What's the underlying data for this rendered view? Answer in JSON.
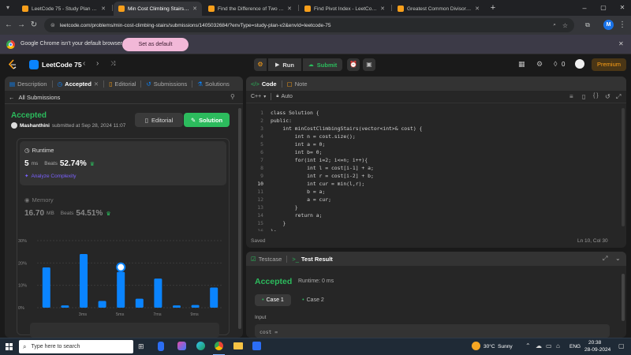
{
  "browser": {
    "tabs": [
      {
        "title": "LeetCode 75 - Study Plan - Leet",
        "active": false,
        "color": "#f89f1b"
      },
      {
        "title": "Min Cost Climbing Stairs - Leetc",
        "active": true,
        "color": "#f89f1b"
      },
      {
        "title": "Find the Difference of Two Arra",
        "active": false,
        "color": "#f89f1b"
      },
      {
        "title": "Find Pivot Index - LeetCode",
        "active": false,
        "color": "#f89f1b"
      },
      {
        "title": "Greatest Common Divisor of St",
        "active": false,
        "color": "#f89f1b"
      }
    ],
    "url": "leetcode.com/problems/min-cost-climbing-stairs/submissions/1405032684/?envType=study-plan-v2&envId=leetcode-75",
    "profile_initial": "M",
    "infobar_text": "Google Chrome isn't your default browser",
    "infobar_button": "Set as default"
  },
  "lc_nav": {
    "title": "LeetCode 75",
    "run": "Run",
    "submit": "Submit",
    "streak": "0",
    "premium": "Premium"
  },
  "left_tabs": {
    "description": "Description",
    "accepted": "Accepted",
    "editorial": "Editorial",
    "submissions": "Submissions",
    "solutions": "Solutions"
  },
  "submission": {
    "back": "All Submissions",
    "status": "Accepted",
    "user": "Mashanthini",
    "submitted": "submitted at Sep 28, 2024 11:07",
    "editorial_btn": "Editorial",
    "solution_btn": "Solution",
    "runtime_label": "Runtime",
    "runtime_value": "5",
    "runtime_unit": "ms",
    "beats_label": "Beats",
    "runtime_beats": "52.74%",
    "analyze": "Analyze Complexity",
    "memory_label": "Memory",
    "memory_value": "16.70",
    "memory_unit": "MB",
    "memory_beats": "54.51%"
  },
  "chart_data": {
    "type": "bar",
    "y_ticks": [
      "30%",
      "20%",
      "10%",
      "0%"
    ],
    "ylim": [
      0,
      30
    ],
    "x_tick_labels": [
      "3ms",
      "5ms",
      "7ms",
      "9ms"
    ],
    "values": [
      18,
      1,
      24,
      3,
      16,
      4,
      13,
      1,
      1.2,
      9
    ],
    "highlight_index": 4,
    "bar_color": "#0a84ff",
    "grid": true
  },
  "editor": {
    "tab_code": "Code",
    "tab_note": "Note",
    "language": "C++",
    "mode": "Auto",
    "lines": [
      "class Solution {",
      "public:",
      "    int minCostClimbingStairs(vector<int>& cost) {",
      "        int n = cost.size();",
      "        int a = 0;",
      "        int b= 0;",
      "        for(int i=2; i<=n; i++){",
      "            int l = cost[i-1] + a;",
      "            int r = cost[i-2] + b;",
      "            int cur = min(l,r);",
      "            b = a;",
      "            a = cur;",
      "        }",
      "        return a;",
      "    }",
      "};"
    ],
    "line_numbers": [
      "1",
      "2",
      "3",
      "4",
      "5",
      "6",
      "7",
      "8",
      "9",
      "10",
      "11",
      "12",
      "13",
      "14",
      "15",
      "16"
    ],
    "current_line": 10,
    "status_left": "Saved",
    "status_right": "Ln 10, Col 30"
  },
  "result": {
    "tab_testcase": "Testcase",
    "tab_result": "Test Result",
    "status": "Accepted",
    "runtime": "Runtime: 0 ms",
    "case1": "Case 1",
    "case2": "Case 2",
    "input_label": "Input",
    "input_var": "cost ="
  },
  "taskbar": {
    "search_placeholder": "Type here to search",
    "weather": "30°C  Sunny",
    "lang": "ENG",
    "time": "20:38",
    "date": "28-09-2024"
  },
  "colors": {
    "green": "#2cbb5d",
    "orange": "#ffa116",
    "blue": "#0a84ff"
  }
}
